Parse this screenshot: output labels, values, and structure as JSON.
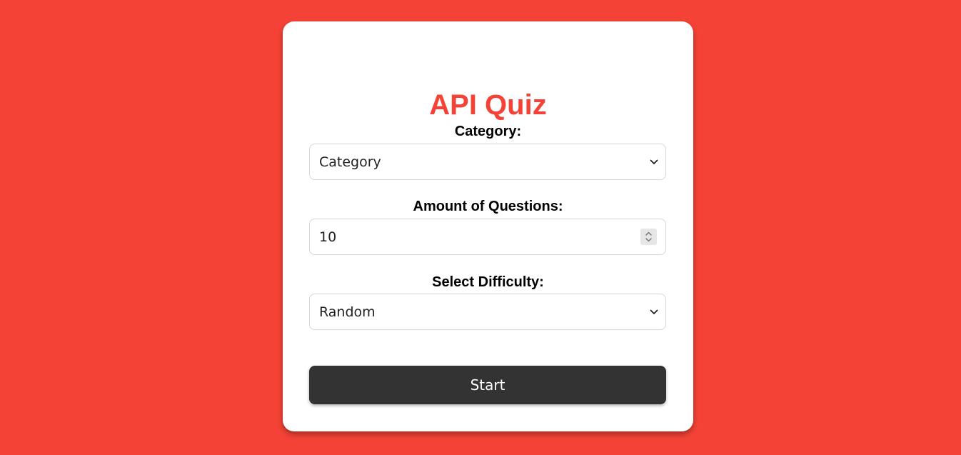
{
  "quiz": {
    "title": "API Quiz",
    "category": {
      "label": "Category:",
      "selected": "Category"
    },
    "amount": {
      "label": "Amount of Questions:",
      "value": "10"
    },
    "difficulty": {
      "label": "Select Difficulty:",
      "selected": "Random"
    },
    "start_label": "Start"
  },
  "colors": {
    "background": "#f44336",
    "accent": "#f44336",
    "button": "#333333",
    "card": "#ffffff"
  },
  "icons": [
    "chevron-down-icon",
    "spinner-arrows-icon"
  ]
}
